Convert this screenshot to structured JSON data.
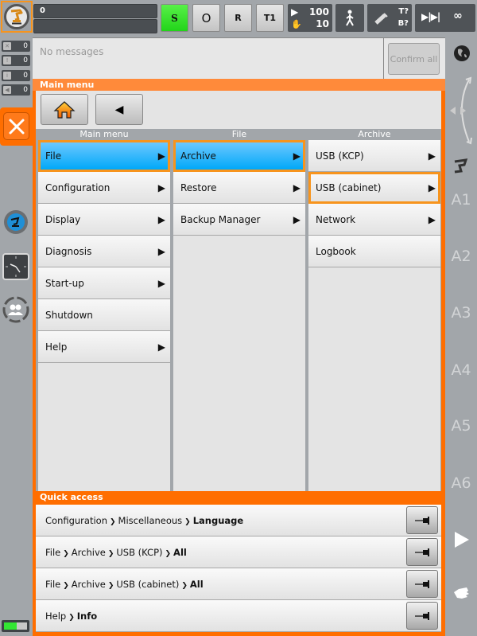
{
  "topbar": {
    "program_line_1": "0",
    "program_line_2": "",
    "submit_label": "S",
    "drives_label": "O",
    "run_label": "R",
    "mode_label": "T1",
    "program_override": "100",
    "jog_override": "10",
    "tool_label": "T?",
    "base_label": "B?",
    "increment_label": "▶|▶|",
    "increment_value": "∞",
    "submit_color": "#22d41a"
  },
  "message_counters": [
    {
      "icon": "error-icon",
      "count": "0"
    },
    {
      "icon": "warning-icon",
      "count": "0"
    },
    {
      "icon": "info-icon",
      "count": "0"
    },
    {
      "icon": "dialog-icon",
      "count": "0"
    }
  ],
  "messages": {
    "text": "No messages",
    "confirm_all_label": "Confirm all"
  },
  "main_menu": {
    "title": "Main menu",
    "columns": [
      {
        "header": "Main menu",
        "items": [
          {
            "label": "File",
            "arrow": "▶",
            "state": "selected"
          },
          {
            "label": "Configuration",
            "arrow": "▶",
            "state": ""
          },
          {
            "label": "Display",
            "arrow": "▶",
            "state": ""
          },
          {
            "label": "Diagnosis",
            "arrow": "▶",
            "state": ""
          },
          {
            "label": "Start-up",
            "arrow": "▶",
            "state": ""
          },
          {
            "label": "Shutdown",
            "arrow": "",
            "state": ""
          },
          {
            "label": "Help",
            "arrow": "▶",
            "state": ""
          }
        ]
      },
      {
        "header": "File",
        "items": [
          {
            "label": "Archive",
            "arrow": "▶",
            "state": "selected"
          },
          {
            "label": "Restore",
            "arrow": "▶",
            "state": ""
          },
          {
            "label": "Backup Manager",
            "arrow": "▶",
            "state": ""
          }
        ]
      },
      {
        "header": "Archive",
        "items": [
          {
            "label": "USB (KCP)",
            "arrow": "▶",
            "state": ""
          },
          {
            "label": "USB (cabinet)",
            "arrow": "▶",
            "state": "focused"
          },
          {
            "label": "Network",
            "arrow": "▶",
            "state": ""
          },
          {
            "label": "Logbook",
            "arrow": "",
            "state": ""
          }
        ]
      }
    ]
  },
  "quick_access": {
    "title": "Quick access",
    "rows": [
      {
        "path": [
          "Configuration",
          "Miscellaneous"
        ],
        "target": "Language"
      },
      {
        "path": [
          "File",
          "Archive",
          "USB (KCP)"
        ],
        "target": "All"
      },
      {
        "path": [
          "File",
          "Archive",
          "USB (cabinet)"
        ],
        "target": "All"
      },
      {
        "path": [
          "Help"
        ],
        "target": "Info"
      }
    ]
  },
  "right_bar": {
    "axes": [
      "A1",
      "A2",
      "A3",
      "A4",
      "A5",
      "A6"
    ]
  },
  "status": {
    "battery_level_percent": 55
  },
  "colors": {
    "accent_orange": "#ff6e00",
    "highlight_border": "#f7941d",
    "selected_blue": "#00a8f8"
  }
}
